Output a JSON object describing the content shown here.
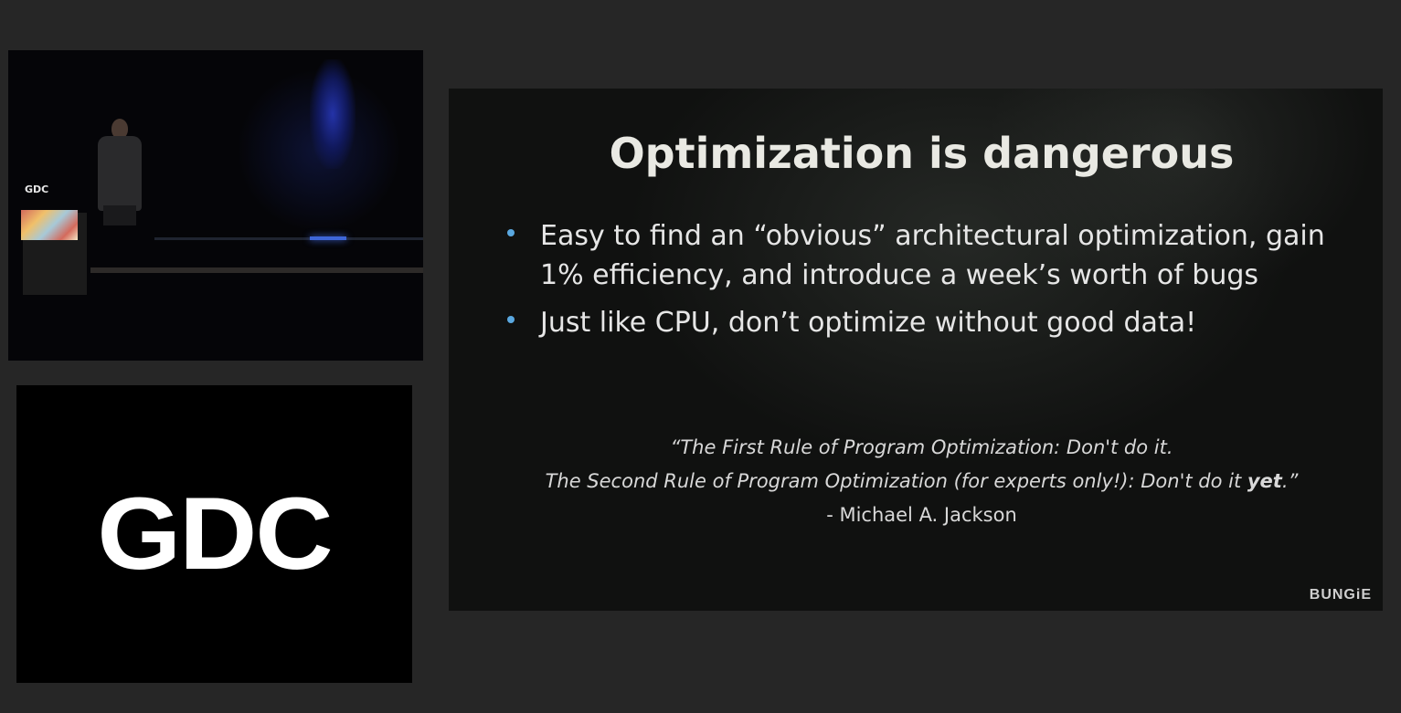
{
  "stage_video": {
    "podium_logo_text": "GDC"
  },
  "brand_panel": {
    "logo_text": "GDC"
  },
  "slide": {
    "title": "Optimization is dangerous",
    "bullets": [
      "Easy to find an “obvious” architectural optimization, gain 1% efficiency, and introduce a week’s worth of bugs",
      "Just like CPU, don’t optimize without good data!"
    ],
    "quote": {
      "line1": "“The First Rule of Program Optimization: Don't do it.",
      "line2_prefix": "The Second Rule of Program Optimization (for experts only!): Don't do it ",
      "line2_emphasis": "yet",
      "line2_suffix": ".”",
      "attribution": "- Michael A. Jackson"
    },
    "corner_logo": "BUNGiE"
  },
  "colors": {
    "background": "#262626",
    "bullet_dot": "#5aa8e0",
    "title_text": "#e9e9e3"
  }
}
